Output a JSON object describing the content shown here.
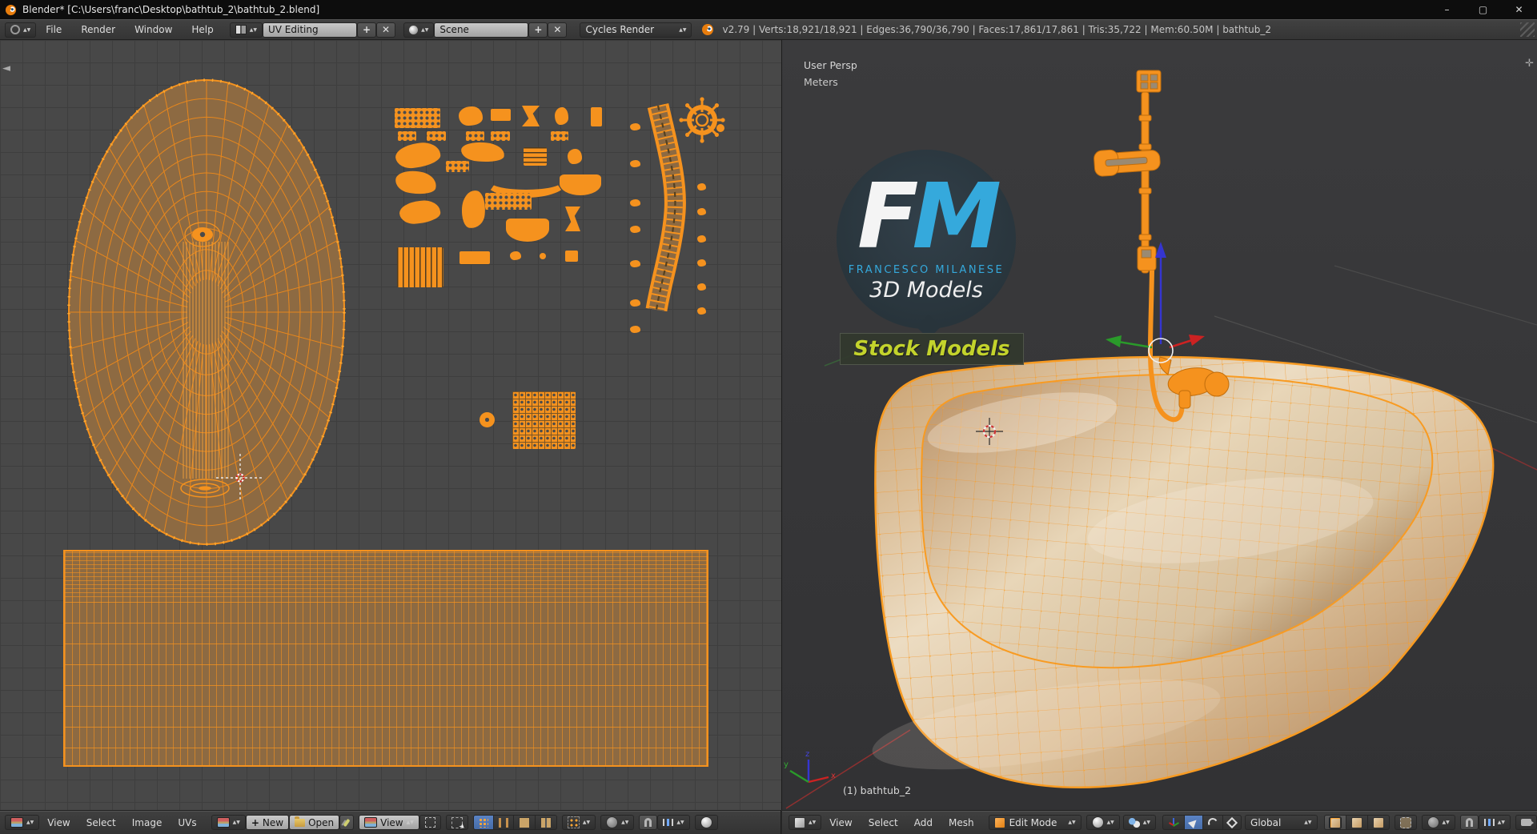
{
  "window": {
    "title": "Blender* [C:\\Users\\franc\\Desktop\\bathtub_2\\bathtub_2.blend]",
    "minimize": "–",
    "maximize": "▢",
    "close": "✕"
  },
  "topbar": {
    "menus": [
      "File",
      "Render",
      "Window",
      "Help"
    ],
    "layout_name": "UV Editing",
    "scene_name": "Scene",
    "engine": "Cycles Render",
    "add_label": "+",
    "close_label": "✕",
    "stats": "v2.79 | Verts:18,921/18,921 | Edges:36,790/36,790 | Faces:17,861/17,861 | Tris:35,722 | Mem:60.50M | bathtub_2"
  },
  "uv_editor": {
    "menus": [
      "View",
      "Select",
      "Image",
      "UVs"
    ],
    "new_button": "New",
    "open_button": "Open",
    "view_dropdown": "View"
  },
  "viewport": {
    "menus": [
      "View",
      "Select",
      "Add",
      "Mesh"
    ],
    "mode": "Edit Mode",
    "orientation": "Global",
    "overlay_view": "User Persp",
    "overlay_unit": "Meters",
    "object_info": "(1) bathtub_2",
    "axis_labels": {
      "x": "x",
      "y": "y",
      "z": "z"
    }
  },
  "watermark": {
    "initial_f": "F",
    "initial_m": "M",
    "name": "FRANCESCO MILANESE",
    "tagline": "3D Models",
    "badge": "Stock Models"
  },
  "colors": {
    "accent_orange": "#f5921e",
    "selection_fill_brown": "#8d6a42",
    "logo_blue": "#35a9dc",
    "badge_yellow": "#c3d32c",
    "axis_red": "#cc2222",
    "axis_green": "#2a9a2a",
    "axis_blue": "#3535d0"
  }
}
